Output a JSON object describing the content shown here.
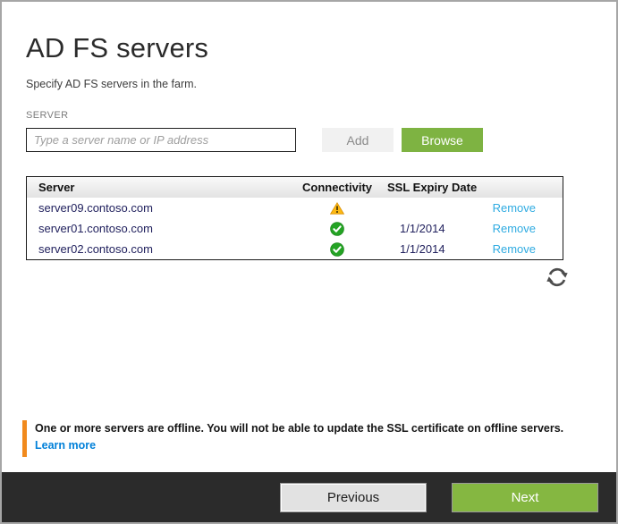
{
  "page": {
    "title": "AD FS servers",
    "subtitle": "Specify AD FS servers in the farm."
  },
  "server_form": {
    "label": "SERVER",
    "input_value": "",
    "input_placeholder": "Type a server name or IP address",
    "add_label": "Add",
    "browse_label": "Browse"
  },
  "table": {
    "columns": [
      "Server",
      "Connectivity",
      "SSL Expiry Date",
      ""
    ],
    "rows": [
      {
        "server": "server09.contoso.com",
        "connectivity": "warning",
        "ssl_expiry": "",
        "action": "Remove"
      },
      {
        "server": "server01.contoso.com",
        "connectivity": "ok",
        "ssl_expiry": "1/1/2014",
        "action": "Remove"
      },
      {
        "server": "server02.contoso.com",
        "connectivity": "ok",
        "ssl_expiry": "1/1/2014",
        "action": "Remove"
      }
    ]
  },
  "icons": {
    "refresh": "refresh-icon",
    "warning": "warning-icon",
    "success": "success-check-icon"
  },
  "warning": {
    "message": "One or more servers are offline. You will not be able to update the SSL certificate on offline servers.",
    "link_label": "Learn more"
  },
  "footer": {
    "previous_label": "Previous",
    "next_label": "Next"
  },
  "colors": {
    "accent_green": "#7eb342",
    "next_green": "#85b741",
    "remove_link_blue": "#2fabe1",
    "learn_more_blue": "#0080d9",
    "warning_bar_orange": "#f18a1d",
    "warning_icon_amber": "#fdb912",
    "success_icon_green": "#24a324",
    "server_text_navy": "#21215e",
    "footer_dark": "#2b2b2b"
  }
}
